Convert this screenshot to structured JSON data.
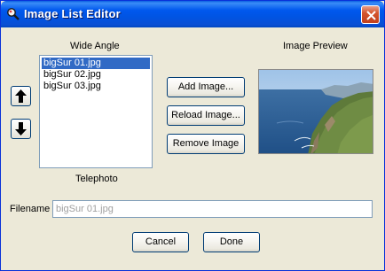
{
  "window": {
    "title": "Image List Editor",
    "accent_color": "#0054e3",
    "close_color": "#c1401c"
  },
  "labels": {
    "wide_angle": "Wide Angle",
    "telephoto": "Telephoto",
    "image_preview": "Image Preview",
    "filename": "Filename"
  },
  "image_list": {
    "items": [
      {
        "label": "bigSur 01.jpg",
        "selected": true
      },
      {
        "label": "bigSur 02.jpg",
        "selected": false
      },
      {
        "label": "bigSur 03.jpg",
        "selected": false
      }
    ],
    "selection_color": "#316ac5"
  },
  "move_buttons": {
    "up_icon": "arrow-up-icon",
    "down_icon": "arrow-down-icon"
  },
  "actions": {
    "add_label": "Add Image...",
    "reload_label": "Reload Image...",
    "remove_label": "Remove Image"
  },
  "filename_field": {
    "value": "bigSur 01.jpg",
    "disabled": true
  },
  "footer": {
    "cancel_label": "Cancel",
    "done_label": "Done"
  }
}
